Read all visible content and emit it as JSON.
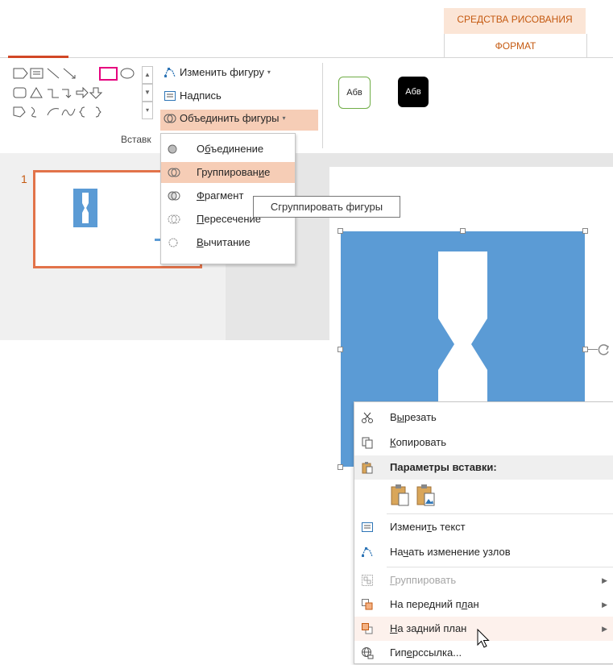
{
  "contextual_tab": {
    "header": "СРЕДСТВА РИСОВАНИЯ",
    "tab": "ФОРМАТ"
  },
  "ribbon": {
    "edit_shape_label": "Изменить фигуру",
    "text_box_label": "Надпись",
    "merge_shapes_label": "Объединить фигуры",
    "group_label": "Вставк",
    "style_sample_1": "Абв",
    "style_sample_2": "Абв"
  },
  "merge_menu": {
    "items": [
      {
        "pre": "О",
        "u": "б",
        "post": "ъединение"
      },
      {
        "pre": "Группирован",
        "u": "и",
        "post": "е"
      },
      {
        "pre": "",
        "u": "Ф",
        "post": "рагмент"
      },
      {
        "pre": "",
        "u": "П",
        "post": "ересечение"
      },
      {
        "pre": "",
        "u": "В",
        "post": "ычитание"
      }
    ]
  },
  "tooltip": "Сгруппировать фигуры",
  "slides": {
    "slide_number": "1"
  },
  "context_menu": {
    "cut": {
      "pre": "В",
      "u": "ы",
      "post": "резать"
    },
    "copy": {
      "pre": "",
      "u": "К",
      "post": "опировать"
    },
    "paste_options": "Параметры вставки:",
    "edit_text": {
      "pre": "Измени",
      "u": "т",
      "post": "ь текст"
    },
    "edit_points": {
      "pre": "На",
      "u": "ч",
      "post": "ать изменение узлов"
    },
    "group": {
      "pre": "",
      "u": "Г",
      "post": "руппировать"
    },
    "bring_front": {
      "pre": "На передний п",
      "u": "л",
      "post": "ан"
    },
    "send_back": {
      "pre": "",
      "u": "Н",
      "post": "а задний план"
    },
    "hyperlink": {
      "pre": "Гип",
      "u": "е",
      "post": "рссылка..."
    }
  },
  "colors": {
    "accent": "#c55a11",
    "shape_fill": "#5b9bd5",
    "selection_border": "#e2734a",
    "highlight": "#f6cdb6"
  }
}
